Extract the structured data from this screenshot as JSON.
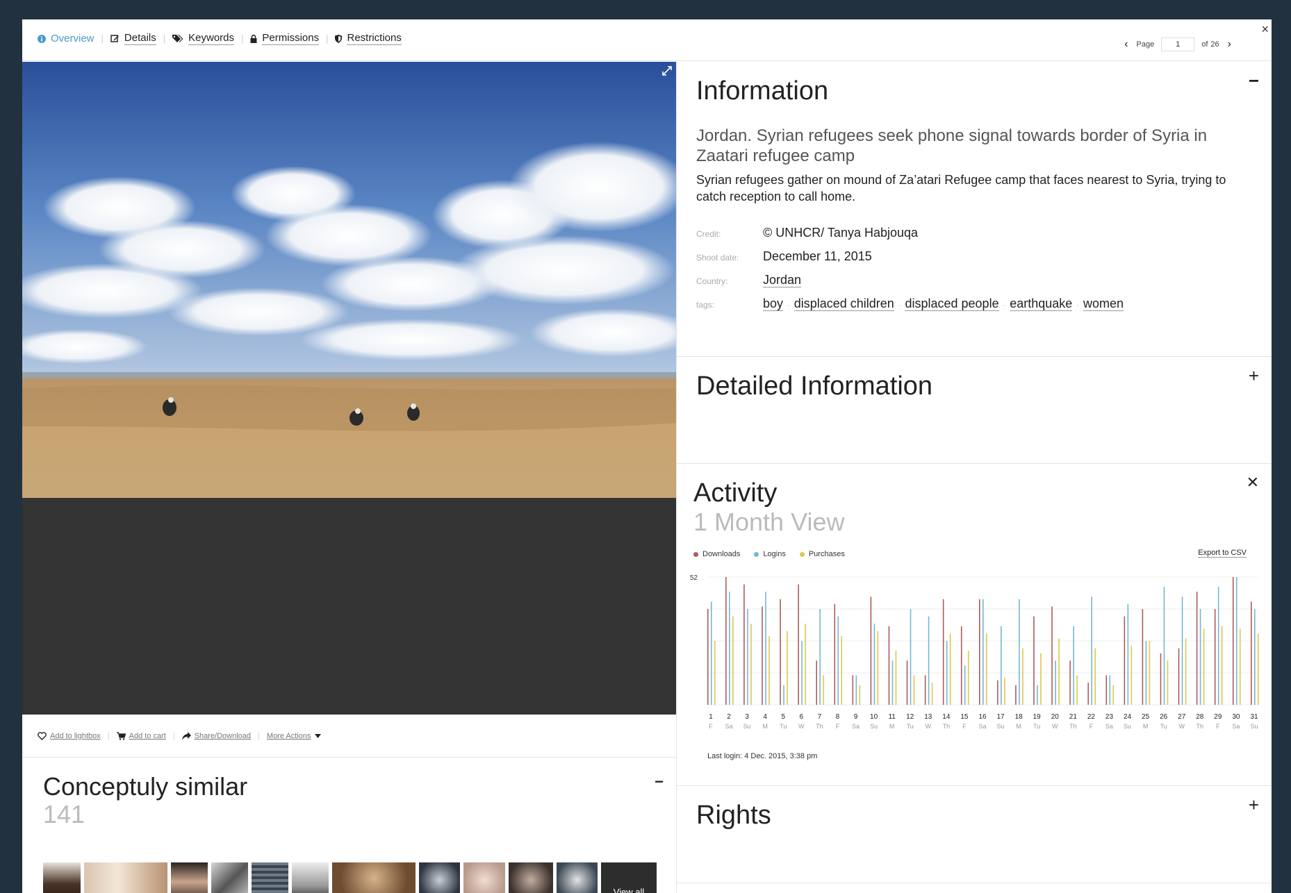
{
  "nav": {
    "tabs": [
      {
        "label": "Overview",
        "icon": "info-icon",
        "active": true
      },
      {
        "label": "Details",
        "icon": "edit-icon"
      },
      {
        "label": "Keywords",
        "icon": "tags-icon"
      },
      {
        "label": "Permissions",
        "icon": "lock-icon"
      },
      {
        "label": "Restrictions",
        "icon": "shield-icon"
      }
    ],
    "close": "×"
  },
  "pager": {
    "label": "Page",
    "current": "1",
    "of": "of",
    "total": "26"
  },
  "actions": {
    "lightbox": "Add to lightbox",
    "cart": "Add to cart",
    "share": "Share/Download",
    "more": "More Actions"
  },
  "similar": {
    "title": "Conceptuly similar",
    "count": "141",
    "view_all": "View all"
  },
  "info": {
    "heading": "Information",
    "title": "Jordan.  Syrian refugees seek phone signal towards border of Syria in Zaatari refugee camp",
    "description": "Syrian refugees gather on mound of Za’atari Refugee camp that faces nearest to Syria, trying to catch reception to call home.",
    "credit_label": "Credit:",
    "credit": "© UNHCR/ Tanya Habjouqa",
    "date_label": "Shoot date:",
    "date": "December 11, 2015",
    "country_label": "Country:",
    "country": "Jordan",
    "tags_label": "tags:",
    "tags": [
      "boy",
      "displaced children",
      "displaced people",
      "earthquake",
      "women"
    ]
  },
  "detailed": {
    "heading": "Detailed Information"
  },
  "activity": {
    "heading": "Activity",
    "subheading": "1 Month View",
    "legend": [
      "Downloads",
      "Logins",
      "Purchases"
    ],
    "export": "Export to CSV",
    "last_login": "Last login: 4 Dec. 2015, 3:38 pm"
  },
  "rights": {
    "heading": "Rights"
  },
  "colors": {
    "downloads": "#b05a5a",
    "logins": "#74b8cf",
    "purchases": "#dcc84a",
    "accent": "#4a9cc7"
  },
  "chart_data": {
    "type": "bar",
    "title": "",
    "ymax_label": "52",
    "ylim": [
      0,
      52
    ],
    "categories": [
      "1",
      "2",
      "3",
      "4",
      "5",
      "6",
      "7",
      "8",
      "9",
      "10",
      "11",
      "12",
      "13",
      "14",
      "15",
      "16",
      "17",
      "18",
      "19",
      "20",
      "21",
      "22",
      "23",
      "24",
      "25",
      "26",
      "27",
      "28",
      "29",
      "30",
      "31"
    ],
    "weekdays": [
      "F",
      "Sa",
      "Su",
      "M",
      "Tu",
      "W",
      "Th",
      "F",
      "Sa",
      "Su",
      "M",
      "Tu",
      "W",
      "Th",
      "F",
      "Sa",
      "Su",
      "M",
      "Tu",
      "W",
      "Th",
      "F",
      "Sa",
      "Su",
      "M",
      "Tu",
      "W",
      "Th",
      "F",
      "Sa",
      "Su"
    ],
    "series": [
      {
        "name": "Downloads",
        "values": [
          39,
          52,
          49,
          40,
          43,
          49,
          18,
          41,
          12,
          44,
          32,
          18,
          12,
          43,
          32,
          43,
          10,
          8,
          36,
          40,
          18,
          9,
          12,
          36,
          39,
          21,
          23,
          46,
          39,
          52,
          42
        ]
      },
      {
        "name": "Logins",
        "values": [
          42,
          46,
          39,
          46,
          8,
          26,
          39,
          36,
          12,
          33,
          18,
          39,
          36,
          26,
          16,
          43,
          32,
          43,
          8,
          18,
          32,
          44,
          12,
          41,
          26,
          48,
          44,
          39,
          48,
          52,
          39
        ]
      },
      {
        "name": "Purchases",
        "values": [
          26,
          36,
          33,
          28,
          30,
          33,
          12,
          28,
          8,
          30,
          22,
          12,
          9,
          29,
          22,
          29,
          11,
          23,
          21,
          27,
          12,
          23,
          8,
          24,
          26,
          18,
          27,
          31,
          32,
          31,
          29
        ]
      }
    ]
  }
}
